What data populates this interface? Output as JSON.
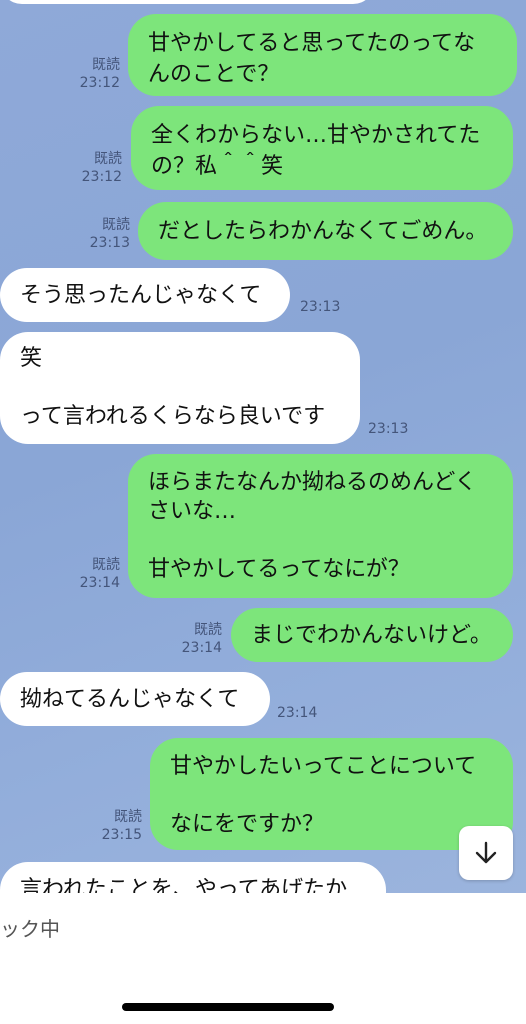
{
  "messages": [
    {
      "side": "me",
      "text": "甘やかしてると思ってたのってな\nんのことで？",
      "read": "既読",
      "time": "23:12"
    },
    {
      "side": "me",
      "text": "全くわからない…甘やかされてた\nの？私＾＾笑",
      "read": "既読",
      "time": "23:12"
    },
    {
      "side": "me",
      "text": "だとしたらわかんなくてごめん。",
      "read": "既読",
      "time": "23:13"
    },
    {
      "side": "them",
      "text": "そう思ったんじゃなくて",
      "time": "23:13"
    },
    {
      "side": "them",
      "text": "笑\n\nって言われるくらなら良いです",
      "time": "23:13"
    },
    {
      "side": "me",
      "text": "ほらまたなんか拗ねるのめんどく\nさいな…\n\n甘やかしてるってなにが？",
      "read": "既読",
      "time": "23:14"
    },
    {
      "side": "me",
      "text": "まじでわかんないけど。",
      "read": "既読",
      "time": "23:14"
    },
    {
      "side": "them",
      "text": "拗ねてるんじゃなくて",
      "time": "23:14"
    },
    {
      "side": "me",
      "text": "甘やかしたいってことについて\n\nなにをですか？",
      "read": "既読",
      "time": "23:15"
    },
    {
      "side": "them",
      "text": "言われたことを、やってあげたか",
      "time": ""
    }
  ],
  "status_text": "ック中",
  "scroll_button_icon": "chevron-down-icon",
  "colors": {
    "chat_background": "#8fa9d8",
    "my_bubble": "#7de57b",
    "their_bubble": "#ffffff"
  }
}
